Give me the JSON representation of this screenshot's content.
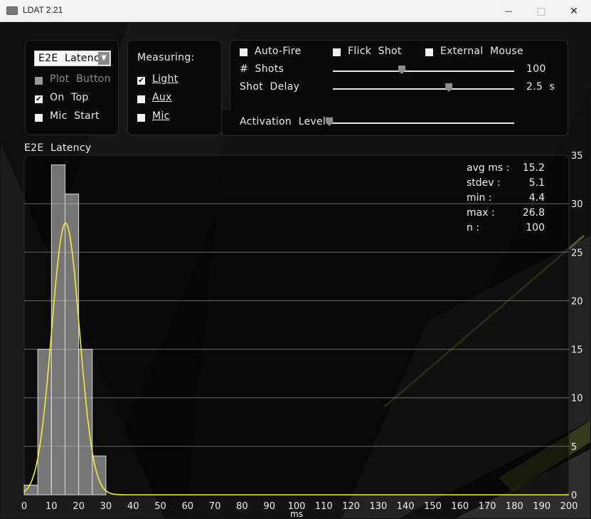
{
  "window": {
    "title": "LDAT 2.21",
    "minimize_glyph": "—",
    "maximize_glyph": "□",
    "close_glyph": "✕"
  },
  "controls": {
    "mode_select": {
      "value": "E2E  Latency",
      "arrow": "▼"
    },
    "plot_button": {
      "label": "Plot  Button",
      "checked": false,
      "enabled": false
    },
    "on_top": {
      "label": "On  Top",
      "checked": true
    },
    "mic_start": {
      "label": "Mic  Start",
      "checked": false
    }
  },
  "measuring": {
    "heading": "Measuring:",
    "light": {
      "label": "Light",
      "checked": true
    },
    "aux": {
      "label": "Aux",
      "checked": false
    },
    "mic": {
      "label": "Mic",
      "checked": false
    }
  },
  "fire": {
    "auto_fire": {
      "label": "Auto-Fire",
      "checked": false
    },
    "flick_shot": {
      "label": "Flick  Shot",
      "checked": false
    },
    "external_mouse": {
      "label": "External  Mouse",
      "checked": false
    },
    "shots": {
      "label": "#  Shots",
      "value": "100",
      "level": 0.38
    },
    "shot_delay": {
      "label": "Shot  Delay",
      "value": "2.5  s",
      "level": 0.64
    }
  },
  "activation": {
    "label": "Activation  Level",
    "level": 0.0
  },
  "chart_data": {
    "type": "bar",
    "title": "E2E  Latency",
    "xlabel": "ms",
    "ylabel": "",
    "xlim": [
      0,
      200
    ],
    "ylim": [
      0,
      35
    ],
    "x_ticks": [
      "0",
      "10",
      "20",
      "30",
      "40",
      "50",
      "60",
      "70",
      "80",
      "90",
      "100",
      "110",
      "120",
      "130",
      "140",
      "150",
      "160",
      "170",
      "180",
      "190",
      "200"
    ],
    "y_ticks": [
      "0",
      "5",
      "10",
      "15",
      "20",
      "25",
      "30",
      "35"
    ],
    "bins": [
      {
        "start": 0,
        "end": 5,
        "count": 1
      },
      {
        "start": 5,
        "end": 10,
        "count": 15
      },
      {
        "start": 10,
        "end": 15,
        "count": 34
      },
      {
        "start": 15,
        "end": 20,
        "count": 31
      },
      {
        "start": 20,
        "end": 25,
        "count": 15
      },
      {
        "start": 25,
        "end": 30,
        "count": 4
      }
    ],
    "fit_curve": {
      "type": "normal",
      "mean": 15.2,
      "stdev": 5.1,
      "peak": 28,
      "color": "#f0f03a"
    },
    "grid": true,
    "stats": [
      {
        "label": "avg  ms  :",
        "value": "15.2"
      },
      {
        "label": "stdev  :",
        "value": "5.1"
      },
      {
        "label": "min  :",
        "value": "4.4"
      },
      {
        "label": "max  :",
        "value": "26.8"
      },
      {
        "label": "n  :",
        "value": "100"
      }
    ]
  }
}
